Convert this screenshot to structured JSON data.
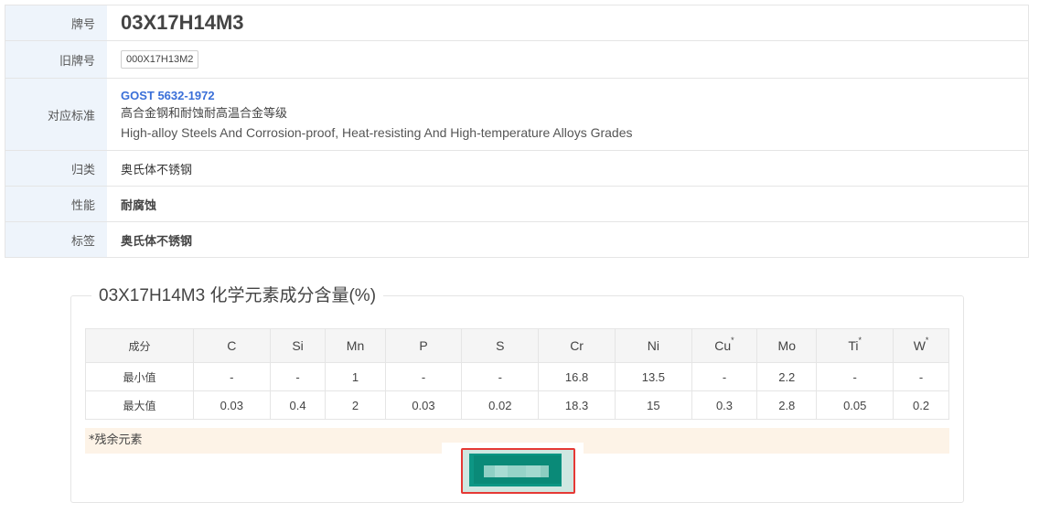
{
  "info": {
    "grade_label": "牌号",
    "grade_value": "03X17H14M3",
    "old_label": "旧牌号",
    "old_value": "000X17H13M2",
    "standard_label": "对应标准",
    "standard_code": "GOST 5632-1972",
    "standard_title_cn": "高合金钢和耐蚀耐高温合金等级",
    "standard_title_en": "High-alloy Steels And Corrosion-proof, Heat-resisting And High-temperature Alloys Grades",
    "category_label": "归类",
    "category_value": "奥氏体不锈钢",
    "property_label": "性能",
    "property_value": "耐腐蚀",
    "tag_label": "标签",
    "tag_value": "奥氏体不锈钢"
  },
  "chem": {
    "legend": "03X17H14M3 化学元素成分含量(%)",
    "header_label": "成分",
    "elements": [
      "C",
      "Si",
      "Mn",
      "P",
      "S",
      "Cr",
      "Ni",
      "Cu",
      "Mo",
      "Ti",
      "W"
    ],
    "residual_mark": "*",
    "min_label": "最小值",
    "min_values": [
      "-",
      "-",
      "1",
      "-",
      "-",
      "16.8",
      "13.5",
      "-",
      "2.2",
      "-",
      "-"
    ],
    "max_label": "最大值",
    "max_values": [
      "0.03",
      "0.4",
      "2",
      "0.03",
      "0.02",
      "18.3",
      "15",
      "0.3",
      "2.8",
      "0.05",
      "0.2"
    ],
    "note": "*残余元素"
  },
  "colors": {
    "accent_link": "#3a6fd8",
    "label_bg": "#eef4fb",
    "button": "#0d9684",
    "highlight_border": "#e53935",
    "note_bg": "#fdf3e7"
  }
}
